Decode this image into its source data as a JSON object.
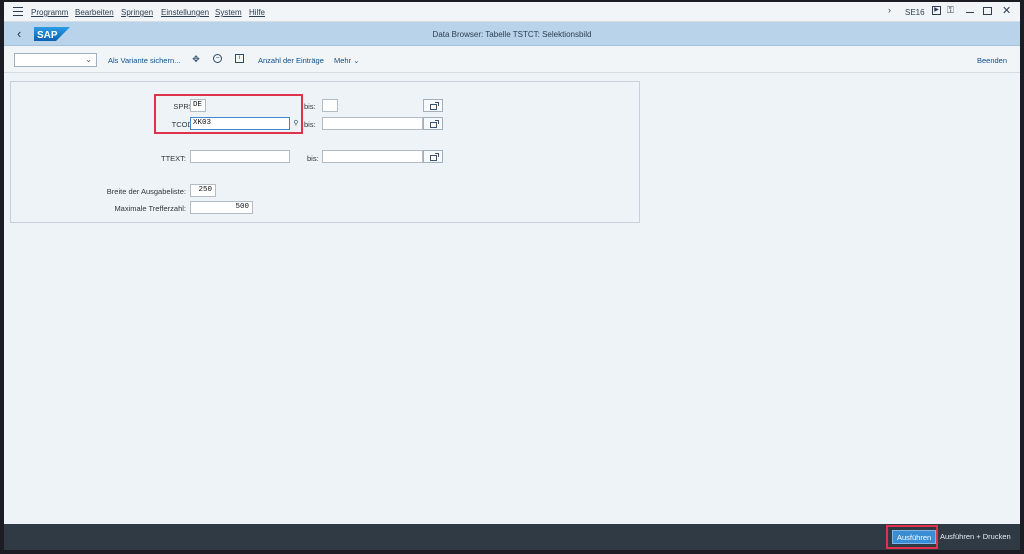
{
  "menubar": {
    "items": [
      "Programm",
      "Bearbeiten",
      "Springen",
      "Einstellungen",
      "System",
      "Hilfe"
    ],
    "tcode": "SE16"
  },
  "titlebar": {
    "title": "Data Browser: Tabelle TSTCT: Selektionsbild",
    "logo": "SAP"
  },
  "toolbar": {
    "variant_value": "",
    "save_variant": "Als Variante sichern...",
    "count_entries": "Anzahl der Einträge",
    "more": "Mehr",
    "exit": "Beenden"
  },
  "selection": {
    "sprsl": {
      "label": "SPRSL:",
      "low": "DE",
      "high_label": "bis:",
      "high": ""
    },
    "tcode": {
      "label": "TCODE:",
      "low": "XK03",
      "high_label": "bis:",
      "high": ""
    },
    "ttext": {
      "label": "TTEXT:",
      "low": "",
      "high_label": "bis:",
      "high": ""
    },
    "output_width": {
      "label": "Breite der Ausgabeliste:",
      "value": "250"
    },
    "max_hits": {
      "label": "Maximale Trefferzahl:",
      "value": "500"
    }
  },
  "footer": {
    "execute": "Ausführen",
    "execute_print": "Ausführen + Drucken"
  },
  "colors": {
    "titlebar": "#b9d3ea",
    "highlight": "#e0324b",
    "primary_button": "#3a8dd2",
    "footer": "#2f3a45"
  }
}
